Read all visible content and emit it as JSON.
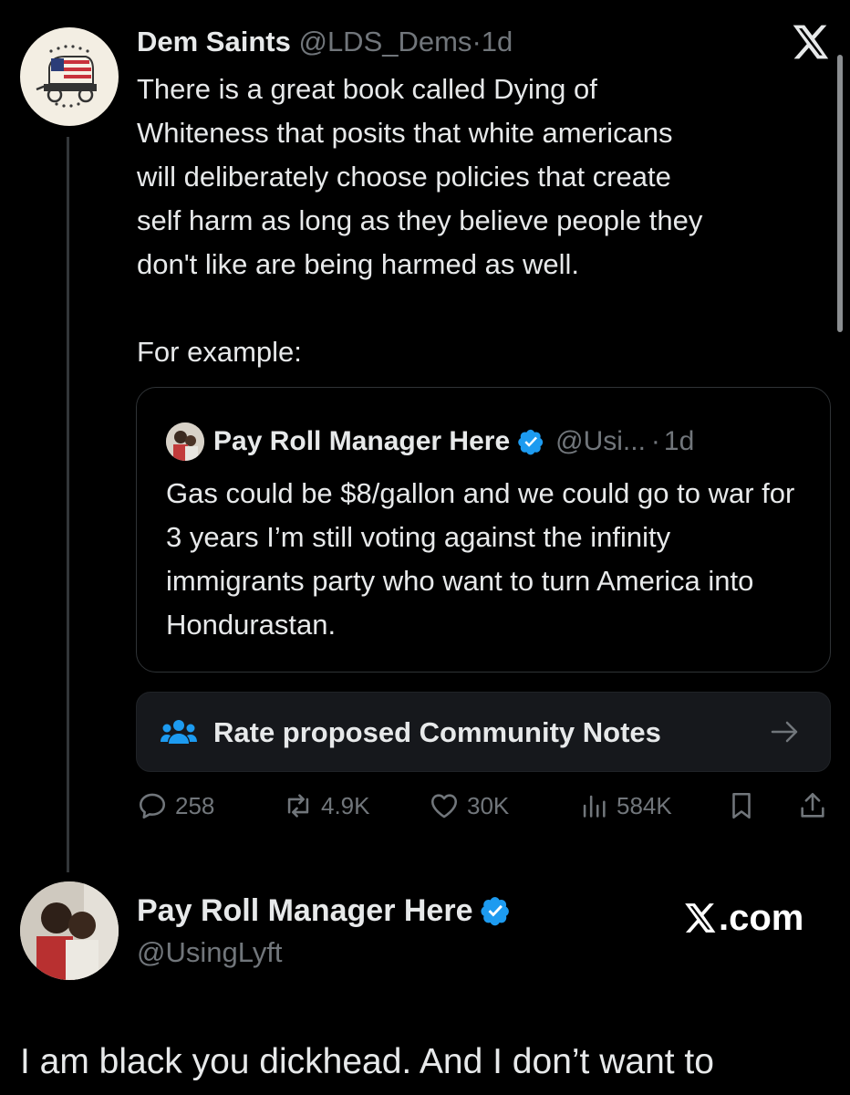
{
  "colors": {
    "background": "#000000",
    "text": "#e7e9ea",
    "muted": "#71767b",
    "verified": "#1d9bf0",
    "border": "#2f3336"
  },
  "tweet": {
    "author_name": "Dem Saints",
    "handle": "@LDS_Dems",
    "separator": "·",
    "time": "1d",
    "avatar_icon": "covered-wagon-logo-icon",
    "text": "There is a great book called Dying of\nWhiteness that posits that white americans\nwill deliberately choose policies that create\nself harm as long as they believe people they\ndon't  like are being harmed as well.\n\nFor example:"
  },
  "quoted_tweet": {
    "author_name": "Pay Roll Manager Here",
    "handle": "@Usi...",
    "separator": "·",
    "time": "1d",
    "text": "Gas could be $8/gallon and we could go to war for 3 years I’m still voting against the infinity immigrants party who want to turn America into Hondurastan."
  },
  "community_notes": {
    "label": "Rate proposed Community Notes",
    "icon": "people-icon",
    "arrow_icon": "arrow-right-icon"
  },
  "actions": {
    "replies": "258",
    "reposts": "4.9K",
    "likes": "30K",
    "views": "584K",
    "bookmark_icon": "bookmark-icon",
    "share_icon": "share-icon"
  },
  "reply": {
    "author_name": "Pay Roll Manager Here",
    "handle": "@UsingLyft",
    "text": "I am black you dickhead. And I don’t want to"
  },
  "watermark": {
    "label": ".com"
  }
}
